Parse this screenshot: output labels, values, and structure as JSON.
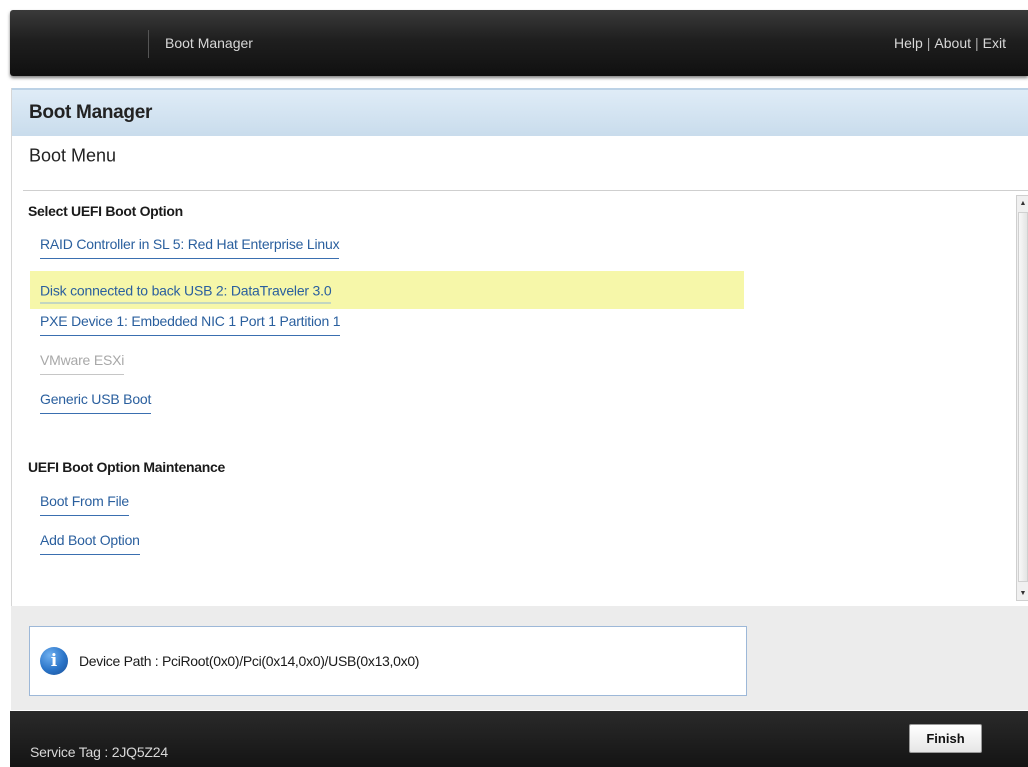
{
  "header": {
    "title": "Boot Manager",
    "links": [
      "Help",
      "About",
      "Exit"
    ],
    "separator": "|"
  },
  "panel": {
    "title": "Boot Manager",
    "heading": "Boot Menu",
    "sections": [
      {
        "label": "Select UEFI Boot Option",
        "options": [
          {
            "label": "RAID Controller in SL 5: Red Hat Enterprise Linux",
            "state": "normal"
          },
          {
            "label": "Disk connected to back USB 2: DataTraveler 3.0",
            "state": "highlighted"
          },
          {
            "label": "PXE Device 1: Embedded NIC 1 Port 1 Partition 1",
            "state": "normal"
          },
          {
            "label": "VMware ESXi",
            "state": "disabled"
          },
          {
            "label": "Generic USB Boot",
            "state": "normal"
          }
        ]
      },
      {
        "label": "UEFI Boot Option Maintenance",
        "options": [
          {
            "label": "Boot From File",
            "state": "normal"
          },
          {
            "label": "Add Boot Option",
            "state": "normal"
          }
        ]
      }
    ]
  },
  "info": {
    "icon": "info-icon",
    "icon_glyph": "i",
    "text": "Device Path : PciRoot(0x0)/Pci(0x14,0x0)/USB(0x13,0x0)"
  },
  "footer": {
    "service_tag": "Service Tag : 2JQ5Z24",
    "finish_label": "Finish"
  },
  "colors": {
    "link": "#2a5f9e",
    "highlight": "#f6f7a9",
    "disabled": "#a8a8a8",
    "header_bg": "#1f1f1f",
    "panel_header_bg": "#c9dcec"
  }
}
